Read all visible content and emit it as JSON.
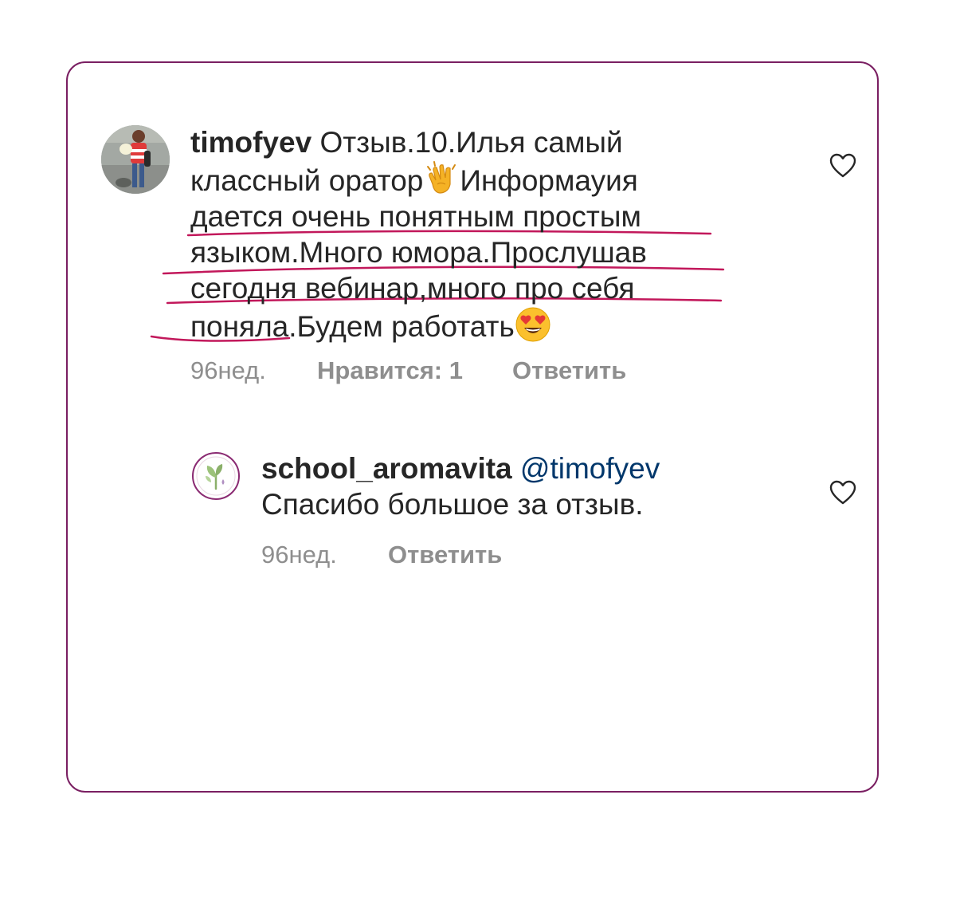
{
  "comment": {
    "username": "timofyev",
    "lines": [
      "Отзыв.10.Илья самый",
      "классный оратор",
      "Информауия",
      "дается  очень понятным простым",
      "языком.Много юмора.Прослушав",
      "сегодня вебинар,много про себя",
      "поняла.Будем работать"
    ],
    "emoji_1": "clapping-hands",
    "emoji_2": "heart-eyes",
    "time": "96нед.",
    "likes": "Нравится: 1",
    "reply_label": "Ответить",
    "underline_color": "#c2185b"
  },
  "reply": {
    "username": "school_aromavita",
    "mention": "@timofyev",
    "text": "Спасибо большое за отзыв.",
    "time": "96нед.",
    "reply_label": "Ответить"
  },
  "colors": {
    "frame_border": "#7a1f62",
    "text": "#262626",
    "meta": "#8e8e8e",
    "mention": "#00376b"
  }
}
